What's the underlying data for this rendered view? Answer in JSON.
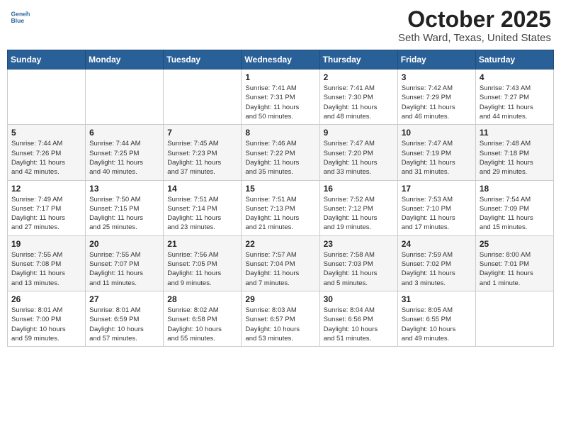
{
  "header": {
    "logo_line1": "General",
    "logo_line2": "Blue",
    "month": "October 2025",
    "location": "Seth Ward, Texas, United States"
  },
  "weekdays": [
    "Sunday",
    "Monday",
    "Tuesday",
    "Wednesday",
    "Thursday",
    "Friday",
    "Saturday"
  ],
  "weeks": [
    [
      {
        "day": "",
        "info": ""
      },
      {
        "day": "",
        "info": ""
      },
      {
        "day": "",
        "info": ""
      },
      {
        "day": "1",
        "info": "Sunrise: 7:41 AM\nSunset: 7:31 PM\nDaylight: 11 hours\nand 50 minutes."
      },
      {
        "day": "2",
        "info": "Sunrise: 7:41 AM\nSunset: 7:30 PM\nDaylight: 11 hours\nand 48 minutes."
      },
      {
        "day": "3",
        "info": "Sunrise: 7:42 AM\nSunset: 7:29 PM\nDaylight: 11 hours\nand 46 minutes."
      },
      {
        "day": "4",
        "info": "Sunrise: 7:43 AM\nSunset: 7:27 PM\nDaylight: 11 hours\nand 44 minutes."
      }
    ],
    [
      {
        "day": "5",
        "info": "Sunrise: 7:44 AM\nSunset: 7:26 PM\nDaylight: 11 hours\nand 42 minutes."
      },
      {
        "day": "6",
        "info": "Sunrise: 7:44 AM\nSunset: 7:25 PM\nDaylight: 11 hours\nand 40 minutes."
      },
      {
        "day": "7",
        "info": "Sunrise: 7:45 AM\nSunset: 7:23 PM\nDaylight: 11 hours\nand 37 minutes."
      },
      {
        "day": "8",
        "info": "Sunrise: 7:46 AM\nSunset: 7:22 PM\nDaylight: 11 hours\nand 35 minutes."
      },
      {
        "day": "9",
        "info": "Sunrise: 7:47 AM\nSunset: 7:20 PM\nDaylight: 11 hours\nand 33 minutes."
      },
      {
        "day": "10",
        "info": "Sunrise: 7:47 AM\nSunset: 7:19 PM\nDaylight: 11 hours\nand 31 minutes."
      },
      {
        "day": "11",
        "info": "Sunrise: 7:48 AM\nSunset: 7:18 PM\nDaylight: 11 hours\nand 29 minutes."
      }
    ],
    [
      {
        "day": "12",
        "info": "Sunrise: 7:49 AM\nSunset: 7:17 PM\nDaylight: 11 hours\nand 27 minutes."
      },
      {
        "day": "13",
        "info": "Sunrise: 7:50 AM\nSunset: 7:15 PM\nDaylight: 11 hours\nand 25 minutes."
      },
      {
        "day": "14",
        "info": "Sunrise: 7:51 AM\nSunset: 7:14 PM\nDaylight: 11 hours\nand 23 minutes."
      },
      {
        "day": "15",
        "info": "Sunrise: 7:51 AM\nSunset: 7:13 PM\nDaylight: 11 hours\nand 21 minutes."
      },
      {
        "day": "16",
        "info": "Sunrise: 7:52 AM\nSunset: 7:12 PM\nDaylight: 11 hours\nand 19 minutes."
      },
      {
        "day": "17",
        "info": "Sunrise: 7:53 AM\nSunset: 7:10 PM\nDaylight: 11 hours\nand 17 minutes."
      },
      {
        "day": "18",
        "info": "Sunrise: 7:54 AM\nSunset: 7:09 PM\nDaylight: 11 hours\nand 15 minutes."
      }
    ],
    [
      {
        "day": "19",
        "info": "Sunrise: 7:55 AM\nSunset: 7:08 PM\nDaylight: 11 hours\nand 13 minutes."
      },
      {
        "day": "20",
        "info": "Sunrise: 7:55 AM\nSunset: 7:07 PM\nDaylight: 11 hours\nand 11 minutes."
      },
      {
        "day": "21",
        "info": "Sunrise: 7:56 AM\nSunset: 7:05 PM\nDaylight: 11 hours\nand 9 minutes."
      },
      {
        "day": "22",
        "info": "Sunrise: 7:57 AM\nSunset: 7:04 PM\nDaylight: 11 hours\nand 7 minutes."
      },
      {
        "day": "23",
        "info": "Sunrise: 7:58 AM\nSunset: 7:03 PM\nDaylight: 11 hours\nand 5 minutes."
      },
      {
        "day": "24",
        "info": "Sunrise: 7:59 AM\nSunset: 7:02 PM\nDaylight: 11 hours\nand 3 minutes."
      },
      {
        "day": "25",
        "info": "Sunrise: 8:00 AM\nSunset: 7:01 PM\nDaylight: 11 hours\nand 1 minute."
      }
    ],
    [
      {
        "day": "26",
        "info": "Sunrise: 8:01 AM\nSunset: 7:00 PM\nDaylight: 10 hours\nand 59 minutes."
      },
      {
        "day": "27",
        "info": "Sunrise: 8:01 AM\nSunset: 6:59 PM\nDaylight: 10 hours\nand 57 minutes."
      },
      {
        "day": "28",
        "info": "Sunrise: 8:02 AM\nSunset: 6:58 PM\nDaylight: 10 hours\nand 55 minutes."
      },
      {
        "day": "29",
        "info": "Sunrise: 8:03 AM\nSunset: 6:57 PM\nDaylight: 10 hours\nand 53 minutes."
      },
      {
        "day": "30",
        "info": "Sunrise: 8:04 AM\nSunset: 6:56 PM\nDaylight: 10 hours\nand 51 minutes."
      },
      {
        "day": "31",
        "info": "Sunrise: 8:05 AM\nSunset: 6:55 PM\nDaylight: 10 hours\nand 49 minutes."
      },
      {
        "day": "",
        "info": ""
      }
    ]
  ]
}
